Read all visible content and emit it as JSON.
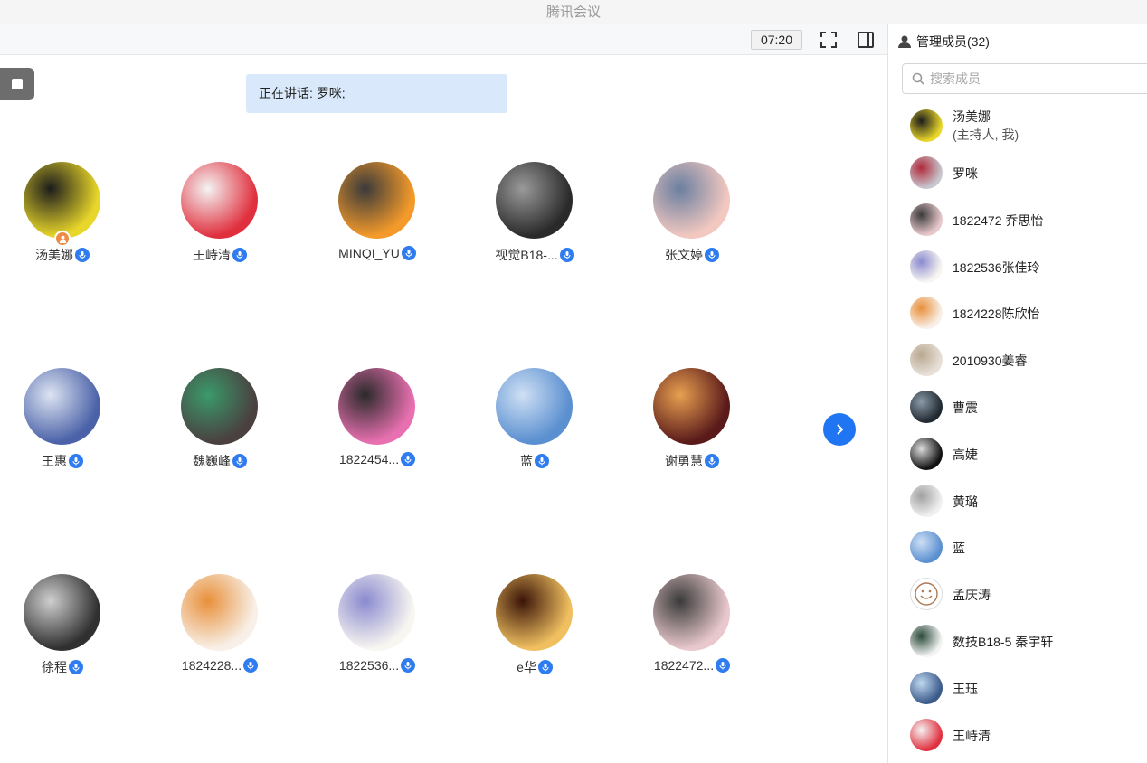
{
  "app": {
    "title": "腾讯会议"
  },
  "toolbar": {
    "timer": "07:20"
  },
  "speaking": {
    "text": "正在讲话: 罗咪;"
  },
  "grid": [
    {
      "name": "汤美娜",
      "host": true,
      "colors": [
        "#e8d62a",
        "#1c1c1c"
      ]
    },
    {
      "name": "王峙清",
      "colors": [
        "#e0303e",
        "#f4f4f4"
      ]
    },
    {
      "name": "MINQI_YU",
      "colors": [
        "#f49a2a",
        "#3a3a3a"
      ]
    },
    {
      "name": "视觉B18-...",
      "colors": [
        "#2a2a2a",
        "#9a9a9a"
      ]
    },
    {
      "name": "张文婷",
      "colors": [
        "#f2c8c0",
        "#6a7fa0"
      ]
    },
    {
      "name": "王惠",
      "colors": [
        "#4b62a8",
        "#dde4f2"
      ]
    },
    {
      "name": "魏巍峰",
      "colors": [
        "#4a4040",
        "#3a9a6a"
      ]
    },
    {
      "name": "1822454...",
      "colors": [
        "#e870b0",
        "#2a2a2a"
      ]
    },
    {
      "name": "蓝",
      "colors": [
        "#5a8fd0",
        "#cfe0f4"
      ]
    },
    {
      "name": "谢勇慧",
      "colors": [
        "#5a1a1a",
        "#e8a050"
      ]
    },
    {
      "name": "徐程",
      "colors": [
        "#303030",
        "#cfcfcf"
      ]
    },
    {
      "name": "1824228...",
      "colors": [
        "#f8f0e8",
        "#e8903a"
      ]
    },
    {
      "name": "1822536...",
      "colors": [
        "#f8f6f0",
        "#8a8ad0"
      ]
    },
    {
      "name": "e华",
      "colors": [
        "#f0c060",
        "#3a1408"
      ]
    },
    {
      "name": "1822472...",
      "colors": [
        "#e8c8cc",
        "#3a3a3a"
      ]
    }
  ],
  "sidebar": {
    "header": "管理成员(32)",
    "search_placeholder": "搜索成员",
    "members": [
      {
        "name": "汤美娜",
        "sub": "(主持人, 我)",
        "colors": [
          "#e8d62a",
          "#1c1c1c"
        ]
      },
      {
        "name": "罗咪",
        "colors": [
          "#c7c7cf",
          "#b02a3a"
        ]
      },
      {
        "name": "1822472 乔思怡",
        "colors": [
          "#e8c8cc",
          "#3a3a3a"
        ]
      },
      {
        "name": "1822536张佳玲",
        "colors": [
          "#f8f6f0",
          "#8a8ad0"
        ]
      },
      {
        "name": "1824228陈欣怡",
        "colors": [
          "#f8f0e8",
          "#e8903a"
        ]
      },
      {
        "name": "2010930姜睿",
        "colors": [
          "#e8e0d8",
          "#b8a890"
        ]
      },
      {
        "name": "曹震",
        "colors": [
          "#202830",
          "#8a9aa8"
        ]
      },
      {
        "name": "高婕",
        "colors": [
          "#111111",
          "#dcdcdc"
        ]
      },
      {
        "name": "黄璐",
        "colors": [
          "#f0f0f0",
          "#a0a0a0"
        ]
      },
      {
        "name": "蓝",
        "colors": [
          "#5a8fd0",
          "#cfe0f4"
        ]
      },
      {
        "name": "孟庆涛",
        "colors": [
          "#ffffff",
          "#c08060"
        ],
        "smiley": true
      },
      {
        "name": "数技B18-5 秦宇轩",
        "colors": [
          "#f4f4f4",
          "#2a4a3a"
        ]
      },
      {
        "name": "王珏",
        "colors": [
          "#3a5a8a",
          "#c0d8f0"
        ]
      },
      {
        "name": "王峙清",
        "colors": [
          "#e0303e",
          "#f4f4f4"
        ]
      }
    ]
  },
  "icons": {
    "fullscreen": "fullscreen-icon",
    "sidebar_toggle": "sidebar-toggle-icon",
    "stop": "stop-share-icon",
    "next_page": "chevron-right-icon",
    "mic": "mic-icon",
    "person": "person-icon",
    "search": "search-icon"
  },
  "colors": {
    "accent": "#1f75f2",
    "speaking_bg": "#d9e9fb",
    "host_badge": "#f08b45"
  }
}
